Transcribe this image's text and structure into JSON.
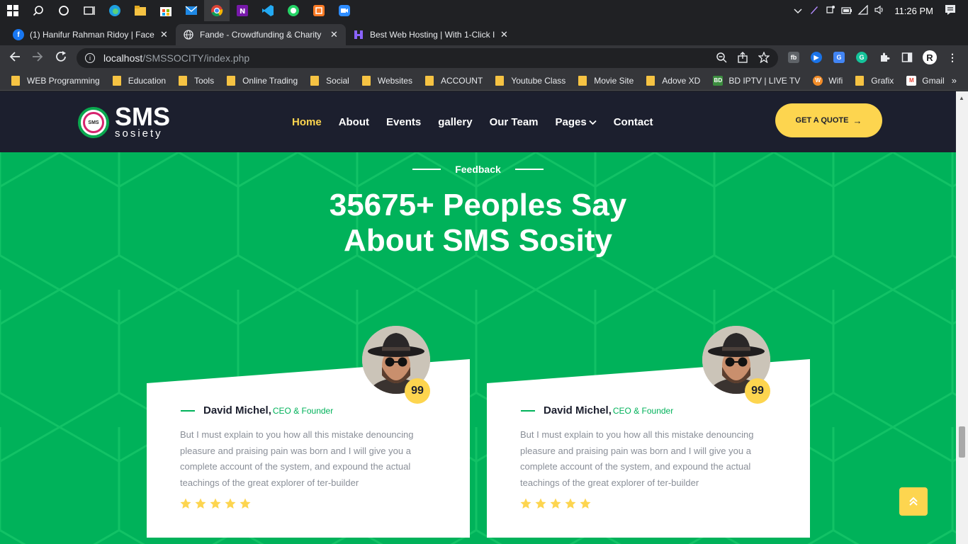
{
  "taskbar": {
    "icons": [
      "windows-start-icon",
      "search-icon",
      "cortana-icon",
      "task-view-icon",
      "edge-icon",
      "file-explorer-icon",
      "store-icon",
      "mail-icon",
      "chrome-icon",
      "onenote-icon",
      "vscode-icon",
      "whatsapp-icon",
      "xampp-icon",
      "zoom-icon"
    ],
    "clock": "11:26 PM"
  },
  "browser": {
    "tabs": [
      {
        "title": "(1) Hanifur Rahman Ridoy | Faceb",
        "favicon": "facebook-icon",
        "color": "#1877f2",
        "active": false
      },
      {
        "title": "Fande - Crowdfunding & Charity",
        "favicon": "globe-icon",
        "color": "#5f6368",
        "active": true
      },
      {
        "title": "Best Web Hosting | With 1-Click I",
        "favicon": "hostinger-icon",
        "color": "#673de6",
        "active": false
      }
    ],
    "url_host": "localhost",
    "url_path": "/SMSSOCITY/index.php",
    "bookmarks": [
      {
        "label": "WEB Programming",
        "type": "folder"
      },
      {
        "label": "Education",
        "type": "folder"
      },
      {
        "label": "Tools",
        "type": "folder"
      },
      {
        "label": "Online Trading",
        "type": "folder"
      },
      {
        "label": "Social",
        "type": "folder"
      },
      {
        "label": "Websites",
        "type": "folder"
      },
      {
        "label": "ACCOUNT",
        "type": "folder"
      },
      {
        "label": "Youtube Class",
        "type": "folder"
      },
      {
        "label": "Movie Site",
        "type": "folder"
      },
      {
        "label": "Adove XD",
        "type": "folder"
      },
      {
        "label": "BD IPTV | LIVE TV",
        "type": "site",
        "favicon_text": "BD",
        "color": "#3c8d3f"
      },
      {
        "label": "Wifi",
        "type": "site",
        "favicon_text": "W",
        "color": "#f28c28"
      },
      {
        "label": "Grafix",
        "type": "folder"
      },
      {
        "label": "Gmail",
        "type": "site",
        "favicon_text": "M",
        "color": "#ea4335"
      }
    ],
    "bookmarks_more": "»"
  },
  "site": {
    "logo_main": "SMS",
    "logo_sub": "sosiety",
    "logo_badge_text": "SMS",
    "nav": [
      "Home",
      "About",
      "Events",
      "gallery",
      "Our Team",
      "Pages",
      "Contact"
    ],
    "nav_active": "Home",
    "nav_dropdown_icon": "chevron-down-icon",
    "cta": "GET A QUOTE",
    "accent": "#fdd54f",
    "green": "#00b25a",
    "header_bg": "#1c1f2e"
  },
  "feedback": {
    "tag": "Feedback",
    "heading_line1": "35675+ Peoples Say",
    "heading_line2": "About SMS Sosity",
    "cards": [
      {
        "name": "David Michel,",
        "role": "CEO & Founder",
        "text": "But I must explain to you how all this mistake denouncing pleasure and praising pain was born and I will give you a complete account of the system, and expound the actual teachings of the great explorer of ter-builder",
        "rating": 5
      },
      {
        "name": "David Michel,",
        "role": "CEO & Founder",
        "text": "But I must explain to you how all this mistake denouncing pleasure and praising pain was born and I will give you a complete account of the system, and expound the actual teachings of the great explorer of ter-builder",
        "rating": 5
      }
    ],
    "quote_mark": "99"
  }
}
